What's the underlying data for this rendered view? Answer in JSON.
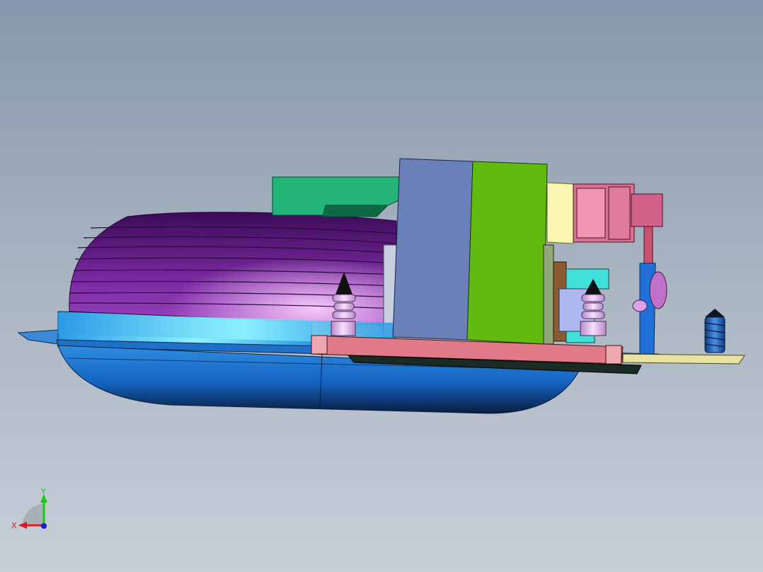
{
  "viewport": {
    "background_top": "#8797ad",
    "background_bottom": "#c7cfd8"
  },
  "model": {
    "colors": {
      "dome": "#5a1a78",
      "dome_highlight": "#e8a8f4",
      "base_plate": "#2b86d8",
      "base_shell": "#1a6ac8",
      "cyan_band": "#4fe0ff",
      "green_bracket": "#1aa870",
      "blue_block": "#6a7fb8",
      "green_block": "#5fb80e",
      "yellow_panel": "#f7f5a8",
      "pink_connector": "#e07090",
      "pcb": "#e07a88",
      "turquoise": "#40e0d0",
      "screw": "#2060b0",
      "lead": "#e8e2a0",
      "dark_plate": "#1a2a20"
    }
  },
  "triad": {
    "x_label": "X",
    "y_label": "Y",
    "x_color": "#e01818",
    "y_color": "#18c818",
    "z_color": "#1818e0"
  }
}
